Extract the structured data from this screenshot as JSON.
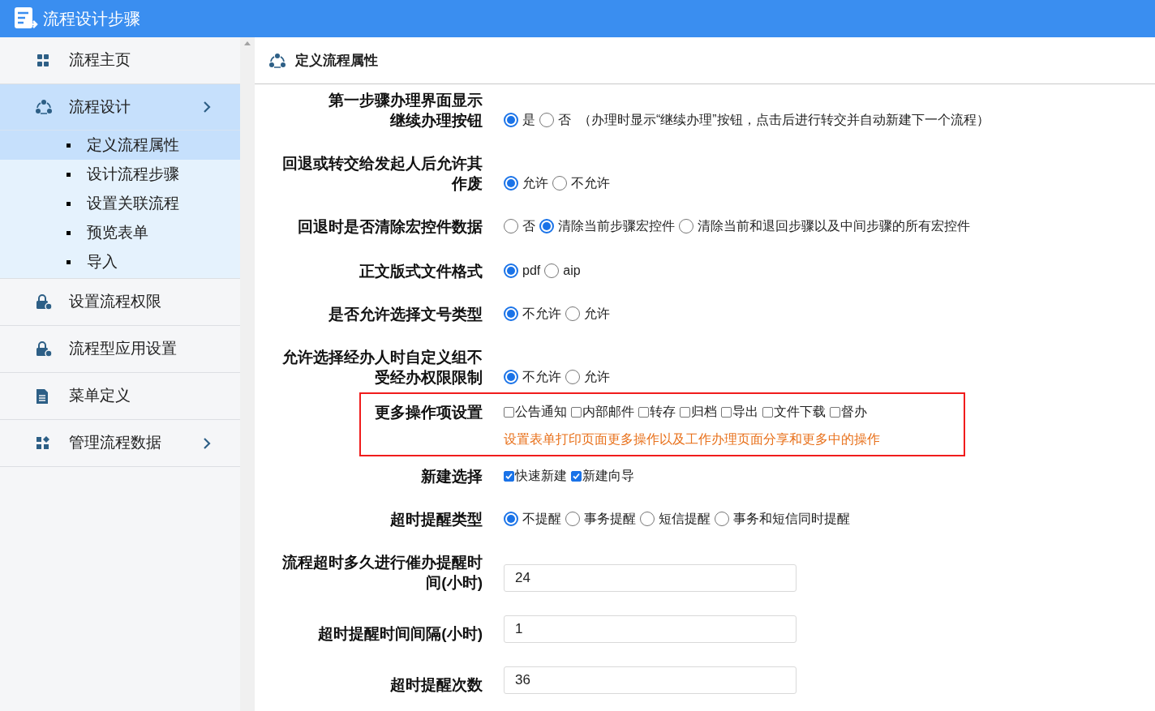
{
  "header": {
    "title": "流程设计步骤"
  },
  "sidebar": {
    "items": [
      {
        "label": "流程主页",
        "selected": false
      },
      {
        "label": "流程设计",
        "selected": true,
        "expanded": true,
        "children": [
          {
            "label": "定义流程属性",
            "selected": true
          },
          {
            "label": "设计流程步骤",
            "selected": false
          },
          {
            "label": "设置关联流程",
            "selected": false
          },
          {
            "label": "预览表单",
            "selected": false
          },
          {
            "label": "导入",
            "selected": false
          }
        ]
      },
      {
        "label": "设置流程权限",
        "selected": false
      },
      {
        "label": "流程型应用设置",
        "selected": false
      },
      {
        "label": "菜单定义",
        "selected": false
      },
      {
        "label": "管理流程数据",
        "selected": false,
        "expanded": false
      }
    ]
  },
  "content": {
    "title": "定义流程属性",
    "fields": [
      {
        "kind": "radio",
        "label": [
          "第一步骤办理界面显示",
          "继续办理按钮"
        ],
        "options": [
          {
            "label": "是",
            "selected": true
          },
          {
            "label": "否",
            "selected": false
          }
        ],
        "note": "（办理时显示“继续办理”按钮，点击后进行转交并自动新建下一个流程）"
      },
      {
        "kind": "radio",
        "label": [
          "回退或转交给发起人后允许其",
          "作废"
        ],
        "options": [
          {
            "label": "允许",
            "selected": true
          },
          {
            "label": "不允许",
            "selected": false
          }
        ]
      },
      {
        "kind": "radio",
        "label": [
          "回退时是否清除宏控件数据"
        ],
        "options": [
          {
            "label": "否",
            "selected": false
          },
          {
            "label": "清除当前步骤宏控件",
            "selected": true
          },
          {
            "label": "清除当前和退回步骤以及中间步骤的所有宏控件",
            "selected": false
          }
        ]
      },
      {
        "kind": "radio",
        "label": [
          "正文版式文件格式"
        ],
        "options": [
          {
            "label": "pdf",
            "selected": true
          },
          {
            "label": "aip",
            "selected": false
          }
        ]
      },
      {
        "kind": "radio",
        "label": [
          "是否允许选择文号类型"
        ],
        "options": [
          {
            "label": "不允许",
            "selected": true
          },
          {
            "label": "允许",
            "selected": false
          }
        ]
      },
      {
        "kind": "radio",
        "label": [
          "允许选择经办人时自定义组不",
          "受经办权限限制"
        ],
        "options": [
          {
            "label": "不允许",
            "selected": true
          },
          {
            "label": "允许",
            "selected": false
          }
        ]
      },
      {
        "kind": "checkbox",
        "highlighted": true,
        "label": [
          "更多操作项设置"
        ],
        "options": [
          {
            "label": "公告通知",
            "checked": false
          },
          {
            "label": "内部邮件",
            "checked": false
          },
          {
            "label": "转存",
            "checked": false
          },
          {
            "label": "归档",
            "checked": false
          },
          {
            "label": "导出",
            "checked": false
          },
          {
            "label": "文件下载",
            "checked": false
          },
          {
            "label": "督办",
            "checked": false
          }
        ],
        "hint": "设置表单打印页面更多操作以及工作办理页面分享和更多中的操作"
      },
      {
        "kind": "checkbox",
        "label": [
          "新建选择"
        ],
        "options": [
          {
            "label": "快速新建",
            "checked": true
          },
          {
            "label": "新建向导",
            "checked": true
          }
        ]
      },
      {
        "kind": "radio",
        "label": [
          "超时提醒类型"
        ],
        "options": [
          {
            "label": "不提醒",
            "selected": true
          },
          {
            "label": "事务提醒",
            "selected": false
          },
          {
            "label": "短信提醒",
            "selected": false
          },
          {
            "label": "事务和短信同时提醒",
            "selected": false
          }
        ]
      },
      {
        "kind": "text",
        "label": [
          "流程超时多久进行催办提醒时",
          "间(小时)"
        ],
        "value": "24"
      },
      {
        "kind": "text",
        "label": [
          "超时提醒时间间隔(小时)"
        ],
        "value": "1"
      },
      {
        "kind": "text",
        "label": [
          "超时提醒次数"
        ],
        "value": "36"
      }
    ]
  }
}
